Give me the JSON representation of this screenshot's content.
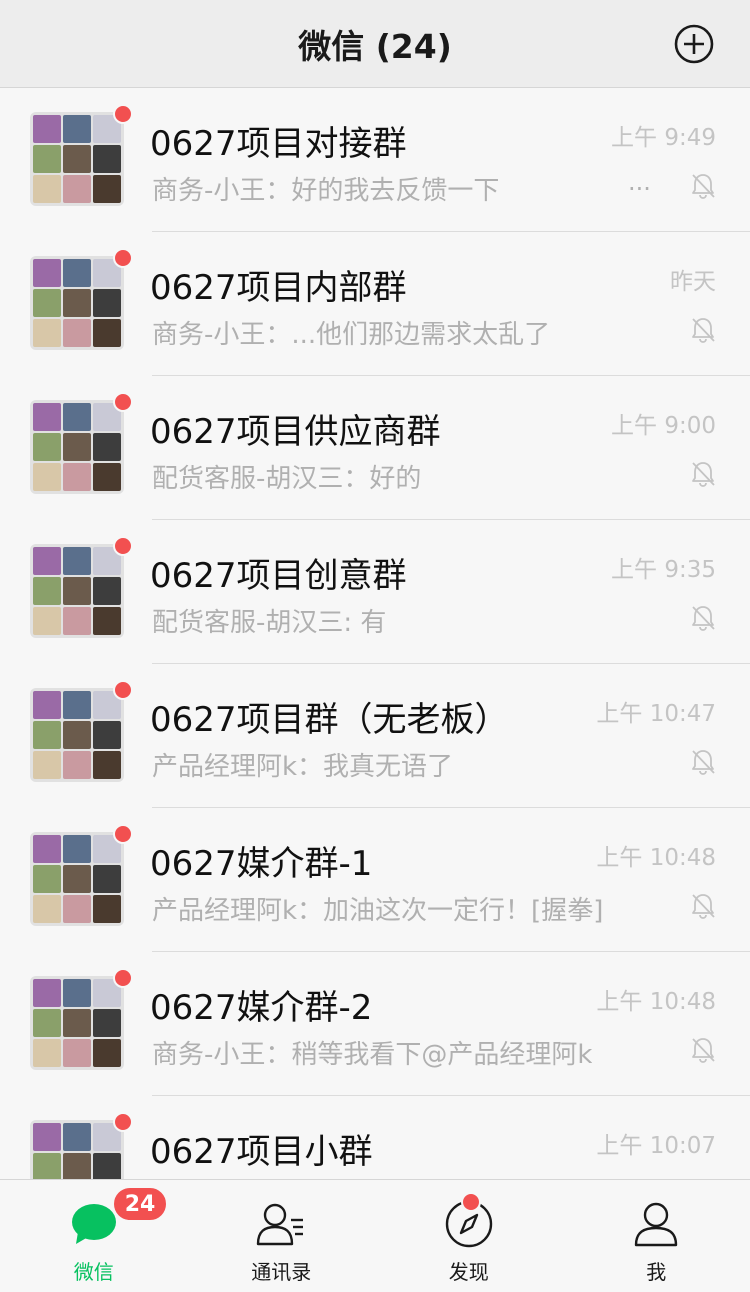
{
  "header": {
    "title": "微信 (24)",
    "add_icon": "plus-circle-icon"
  },
  "chats": [
    {
      "name": "0627项目对接群",
      "preview": "商务-小王：好的我去反馈一下",
      "ellipsis": "...",
      "time": "上午 9:49"
    },
    {
      "name": "0627项目内部群",
      "preview": "商务-小王：...他们那边需求太乱了",
      "ellipsis": "",
      "time": "昨天"
    },
    {
      "name": "0627项目供应商群",
      "preview": "配货客服-胡汉三：好的",
      "ellipsis": "",
      "time": "上午 9:00"
    },
    {
      "name": "0627项目创意群",
      "preview": "配货客服-胡汉三: 有",
      "ellipsis": "",
      "time": "上午 9:35"
    },
    {
      "name": "0627项目群（无老板）",
      "preview": "产品经理阿k：我真无语了",
      "ellipsis": "",
      "time": "上午 10:47"
    },
    {
      "name": "0627媒介群-1",
      "preview": "产品经理阿k：加油这次一定行！[握拳]",
      "ellipsis": "",
      "time": "上午 10:48"
    },
    {
      "name": "0627媒介群-2",
      "preview": "商务-小王：稍等我看下@产品经理阿k",
      "ellipsis": "",
      "time": "上午 10:48"
    },
    {
      "name": "0627项目小群",
      "preview": "",
      "ellipsis": "",
      "time": "上午 10:07"
    }
  ],
  "tabs": [
    {
      "label": "微信",
      "icon": "chat-bubble-icon",
      "badge": "24"
    },
    {
      "label": "通讯录",
      "icon": "contacts-icon"
    },
    {
      "label": "发现",
      "icon": "compass-icon"
    },
    {
      "label": "我",
      "icon": "person-icon"
    }
  ],
  "colors": {
    "accent": "#07c160",
    "badge": "#f25050"
  }
}
